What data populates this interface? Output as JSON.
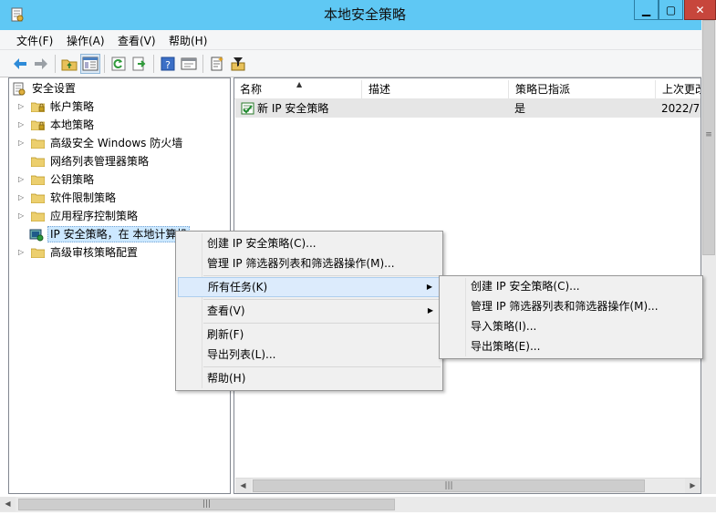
{
  "window": {
    "title": "本地安全策略"
  },
  "menu": [
    "文件(F)",
    "操作(A)",
    "查看(V)",
    "帮助(H)"
  ],
  "toolbar": [
    "back-icon",
    "forward-icon",
    "up-folder-icon",
    "show-hide-tree-icon",
    "refresh-icon",
    "export-icon",
    "help-icon",
    "properties-icon",
    "new-policy-icon",
    "filter-icon"
  ],
  "tree": {
    "root": "安全设置",
    "items": [
      {
        "label": "帐户策略",
        "expandable": true,
        "icon": "locked-folder"
      },
      {
        "label": "本地策略",
        "expandable": true,
        "icon": "locked-folder"
      },
      {
        "label": "高级安全 Windows 防火墙",
        "expandable": true,
        "icon": "folder"
      },
      {
        "label": "网络列表管理器策略",
        "expandable": false,
        "icon": "folder"
      },
      {
        "label": "公钥策略",
        "expandable": true,
        "icon": "folder"
      },
      {
        "label": "软件限制策略",
        "expandable": true,
        "icon": "folder"
      },
      {
        "label": "应用程序控制策略",
        "expandable": true,
        "icon": "folder"
      },
      {
        "label": "IP 安全策略，在 本地计算机",
        "expandable": false,
        "icon": "ipsec-icon",
        "selected": true
      },
      {
        "label": "高级审核策略配置",
        "expandable": true,
        "icon": "folder"
      }
    ]
  },
  "list": {
    "columns": [
      "名称",
      "描述",
      "策略已指派",
      "上次更改"
    ],
    "rows": [
      {
        "name": "新 IP 安全策略",
        "description": "",
        "assigned": "是",
        "modified": "2022/7/"
      }
    ]
  },
  "context_menu": {
    "items": [
      {
        "label": "创建 IP 安全策略(C)..."
      },
      {
        "label": "管理 IP 筛选器列表和筛选器操作(M)..."
      },
      {
        "label": "所有任务(K)",
        "submenu": true,
        "highlighted": true
      },
      {
        "label": "查看(V)",
        "submenu": true
      },
      {
        "label": "刷新(F)"
      },
      {
        "label": "导出列表(L)..."
      },
      {
        "label": "帮助(H)"
      }
    ]
  },
  "submenu": {
    "items": [
      {
        "label": "创建 IP 安全策略(C)..."
      },
      {
        "label": "管理 IP 筛选器列表和筛选器操作(M)..."
      },
      {
        "label": "导入策略(I)..."
      },
      {
        "label": "导出策略(E)..."
      }
    ]
  },
  "colors": {
    "titlebar": "#5fc8f4",
    "close": "#c7463c",
    "highlight": "#dcebfc"
  }
}
